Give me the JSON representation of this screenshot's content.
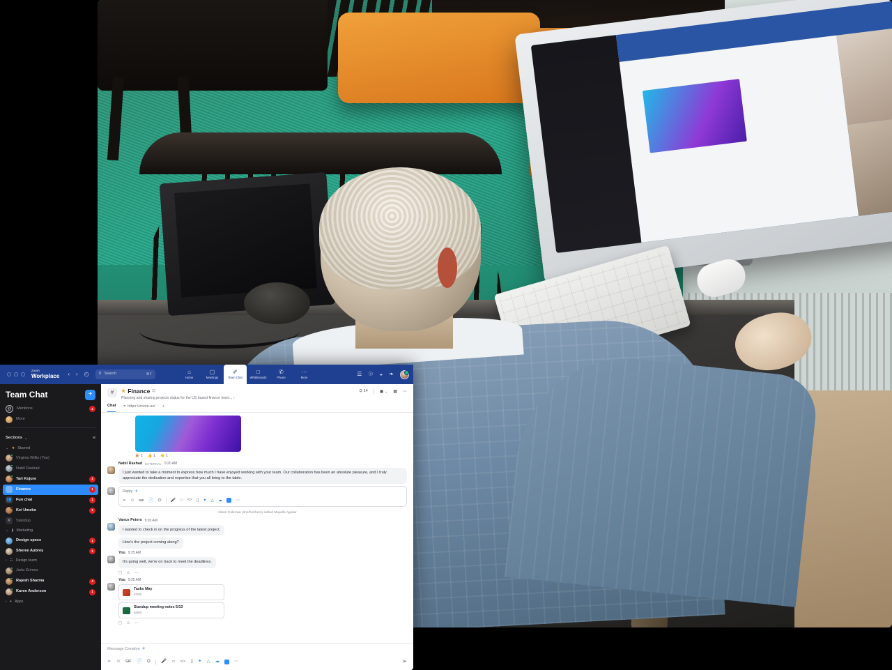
{
  "titlebar": {
    "brand_small": "zoom",
    "brand_big": "Workplace",
    "back_icon": "‹",
    "forward_icon": "›",
    "history_icon": "◴",
    "search_placeholder": "Search",
    "search_shortcut": "⌘F",
    "nav": [
      {
        "label": "Home",
        "icon": "⌂",
        "active": false
      },
      {
        "label": "Meetings",
        "icon": "▢",
        "active": false
      },
      {
        "label": "Team Chat",
        "icon": "✐",
        "active": true
      },
      {
        "label": "Whiteboards",
        "icon": "□",
        "active": false
      },
      {
        "label": "Phone",
        "icon": "✆",
        "active": false
      },
      {
        "label": "More",
        "icon": "⋯",
        "active": false
      }
    ],
    "right_icons": [
      "apps-icon",
      "bell-icon",
      "contrast-icon",
      "share-icon"
    ]
  },
  "sidebar": {
    "title": "Team Chat",
    "add_label": "+",
    "quick": [
      {
        "label": "Mentions",
        "badge": "1",
        "icon": "at-icon"
      },
      {
        "label": "More",
        "badge": "",
        "icon": "bookmark-icon"
      }
    ],
    "sections_label": "Sections",
    "sections_caret": "⌄",
    "filter_icon": "≡",
    "groups": [
      {
        "name": "Starred",
        "caret": "⌄",
        "icon": "star-icon",
        "items": [
          {
            "label": "Virginia Willis (You)",
            "badge": "",
            "presence": "on",
            "muted": true,
            "kind": "avatar"
          },
          {
            "label": "Nabil Rashad",
            "badge": "",
            "presence": "on",
            "muted": true,
            "kind": "avatar"
          },
          {
            "label": "Tari Kojure",
            "badge": "1",
            "presence": "on",
            "muted": false,
            "kind": "avatar"
          },
          {
            "label": "Finance",
            "badge": "1",
            "presence": "",
            "muted": false,
            "kind": "channel",
            "active": true
          },
          {
            "label": "Fun chat",
            "badge": "1",
            "presence": "",
            "muted": false,
            "kind": "group"
          },
          {
            "label": "Kei Umeko",
            "badge": "1",
            "presence": "busy",
            "muted": false,
            "kind": "avatar"
          },
          {
            "label": "Standup",
            "badge": "",
            "presence": "",
            "muted": true,
            "kind": "hash"
          }
        ]
      },
      {
        "name": "Marketing",
        "caret": "⌄",
        "icon": "folder-icon",
        "items": [
          {
            "label": "Design specs",
            "badge": "1",
            "presence": "",
            "muted": false,
            "kind": "avatar"
          },
          {
            "label": "Sheree Aubrey",
            "badge": "1",
            "presence": "",
            "muted": false,
            "kind": "avatar"
          }
        ]
      },
      {
        "name": "Design team",
        "caret": "›",
        "icon": "team-icon",
        "items": [
          {
            "label": "Jada Grimes",
            "badge": "",
            "presence": "on",
            "muted": true,
            "kind": "avatar"
          },
          {
            "label": "Rajesh Sharma",
            "badge": "4",
            "presence": "on",
            "muted": false,
            "kind": "avatar"
          },
          {
            "label": "Karen Anderson",
            "badge": "1",
            "presence": "on",
            "muted": false,
            "kind": "avatar"
          }
        ]
      },
      {
        "name": "Apps",
        "caret": "›",
        "icon": "apps-icon",
        "items": []
      }
    ]
  },
  "channel": {
    "hash_icon": "#",
    "star_icon": "★",
    "name": "Finance",
    "lock_icon": "☐",
    "description": "Planning and sharing projects status for the US based finance team...",
    "description_caret": "›",
    "member_count": "14",
    "member_icon": "⛭",
    "video_icon": "▣",
    "video_caret": "⌄",
    "calendar_icon": "Ὕ3",
    "more_icon": "⋯",
    "tabs": [
      {
        "label": "Chat",
        "active": true,
        "icon": ""
      },
      {
        "label": "https://zoom.us/",
        "active": false,
        "icon": "⚭"
      },
      {
        "label": "+",
        "active": false,
        "icon": ""
      }
    ]
  },
  "messages": {
    "attachment_image_alt": "gradient-image",
    "reactions": [
      {
        "emoji": "🎉",
        "count": "1"
      },
      {
        "emoji": "👍",
        "count": "1"
      },
      {
        "emoji": "👋",
        "count": "1"
      }
    ],
    "items": [
      {
        "author": "Nabil Rashad",
        "tag": "EXTERNAL",
        "time": "9:20 AM",
        "text": "I just wanted to take a moment to express how much I have enjoyed working with your team. Our collaboration has been an absolute pleasure, and I truly appreciate the dedication and expertise that you all bring to the table."
      }
    ],
    "reply": {
      "placeholder": "Reply",
      "pin_icon": "✈",
      "toolbar": [
        "format-icon",
        "emoji-icon",
        "gif-icon",
        "file-icon",
        "screenshot-icon",
        "audio-icon",
        "video-icon",
        "code-icon",
        "screen-icon",
        "zoom-app-icon",
        "drive-icon",
        "onedrive-icon",
        "box-icon",
        "more-icon"
      ]
    },
    "system": "Alison Coleman (she/her/hers) added Mayelle Aguilar",
    "thread": [
      {
        "author": "Vance Peters",
        "time": "9:20 AM",
        "bubbles": [
          "I wanted to check in on the progress of the latest project.",
          "How's the project coming along?"
        ],
        "actions": []
      },
      {
        "author": "You",
        "time": "9:25 AM",
        "bubbles": [
          "It's going well, we're on track to meet the deadlines."
        ],
        "actions": [
          "reply-icon",
          "react-icon",
          "more-icon"
        ]
      }
    ],
    "files_post": {
      "author": "You",
      "time": "9:25 AM",
      "files": [
        {
          "name": "Tasks May",
          "size": "57KB",
          "type": "ppt"
        },
        {
          "name": "Standup meeting notes 5/13",
          "size": "84KB",
          "type": "xls"
        }
      ],
      "actions": [
        "reply-icon",
        "react-icon",
        "more-icon"
      ]
    }
  },
  "composer": {
    "placeholder": "Message Creative",
    "pin_icon": "✈",
    "toolbar": [
      "format-icon",
      "emoji-icon",
      "gif-icon",
      "file-icon",
      "screenshot-icon",
      "audio-icon",
      "video-icon",
      "code-icon",
      "screen-icon",
      "zoom-app-icon",
      "drive-icon",
      "onedrive-icon",
      "box-icon",
      "more-icon"
    ],
    "send_icon": "➤"
  },
  "colors": {
    "brand_blue": "#1f3f91",
    "accent_blue": "#2d8cff",
    "badge_red": "#e02020",
    "sidebar_bg": "#1a1a1c"
  }
}
